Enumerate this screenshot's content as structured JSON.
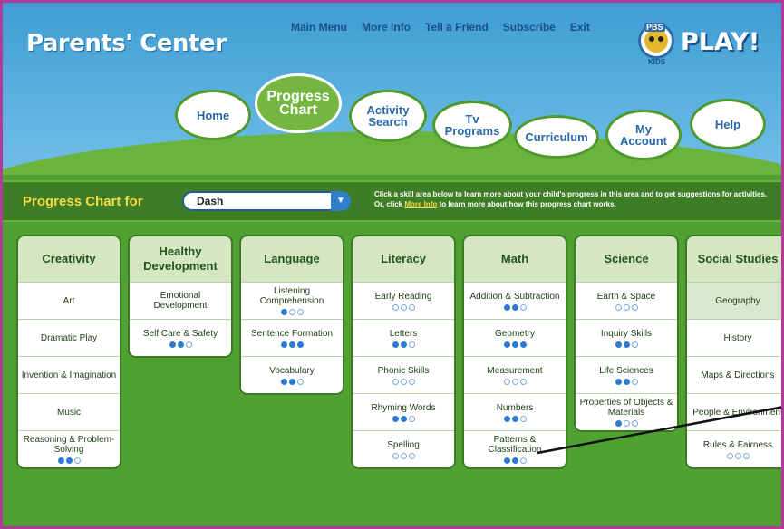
{
  "header": {
    "logo": "Parents' Center",
    "play": "PLAY!",
    "pbs": "PBS",
    "kids": "KIDS"
  },
  "topnav": [
    "Main Menu",
    "More Info",
    "Tell a Friend",
    "Subscribe",
    "Exit"
  ],
  "tabs": {
    "home": "Home",
    "progress": "Progress Chart",
    "activity": "Activity Search",
    "tv": "Tv Programs",
    "curriculum": "Curriculum",
    "account": "My Account",
    "help": "Help"
  },
  "progress_bar": {
    "label": "Progress Chart for",
    "child": "Dash",
    "help_pre": "Click a skill area below to learn more about your child's progress in this area and to get suggestions for activities. Or, click",
    "help_link": "More Info",
    "help_post": "to learn more about how this progress chart works."
  },
  "columns": [
    {
      "title": "Creativity",
      "skills": [
        {
          "name": "Art"
        },
        {
          "name": "Dramatic Play"
        },
        {
          "name": "Invention & Imagination"
        },
        {
          "name": "Music"
        },
        {
          "name": "Reasoning & Problem-Solving",
          "level": 2
        }
      ]
    },
    {
      "title": "Healthy Development",
      "skills": [
        {
          "name": "Emotional Development"
        },
        {
          "name": "Self Care & Safety",
          "level": 2
        }
      ]
    },
    {
      "title": "Language",
      "skills": [
        {
          "name": "Listening Comprehension",
          "level": 1
        },
        {
          "name": "Sentence Formation",
          "level": 3
        },
        {
          "name": "Vocabulary",
          "level": 2
        }
      ]
    },
    {
      "title": "Literacy",
      "skills": [
        {
          "name": "Early Reading",
          "level": 0
        },
        {
          "name": "Letters",
          "level": 2
        },
        {
          "name": "Phonic Skills",
          "level": 0
        },
        {
          "name": "Rhyming Words",
          "level": 2
        },
        {
          "name": "Spelling",
          "level": 0
        }
      ]
    },
    {
      "title": "Math",
      "skills": [
        {
          "name": "Addition & Subtraction",
          "level": 2
        },
        {
          "name": "Geometry",
          "level": 3
        },
        {
          "name": "Measurement",
          "level": 0
        },
        {
          "name": "Numbers",
          "level": 2
        },
        {
          "name": "Patterns & Classification",
          "level": 2
        }
      ]
    },
    {
      "title": "Science",
      "skills": [
        {
          "name": "Earth & Space",
          "level": 0
        },
        {
          "name": "Inquiry Skills",
          "level": 2
        },
        {
          "name": "Life Sciences",
          "level": 2
        },
        {
          "name": "Properties of Objects & Materials",
          "level": 1
        }
      ]
    },
    {
      "title": "Social Studies",
      "skills": [
        {
          "name": "Geography",
          "highlight": true
        },
        {
          "name": "History"
        },
        {
          "name": "Maps & Directions"
        },
        {
          "name": "People & Environment"
        },
        {
          "name": "Rules & Fairness",
          "level": 0
        }
      ]
    }
  ],
  "colors": {
    "sky": "#3f9dd3",
    "grass": "#4fa132",
    "accent_yellow": "#f6da45",
    "progress_dot": "#2d7bd1",
    "frame": "#b23a9a"
  }
}
